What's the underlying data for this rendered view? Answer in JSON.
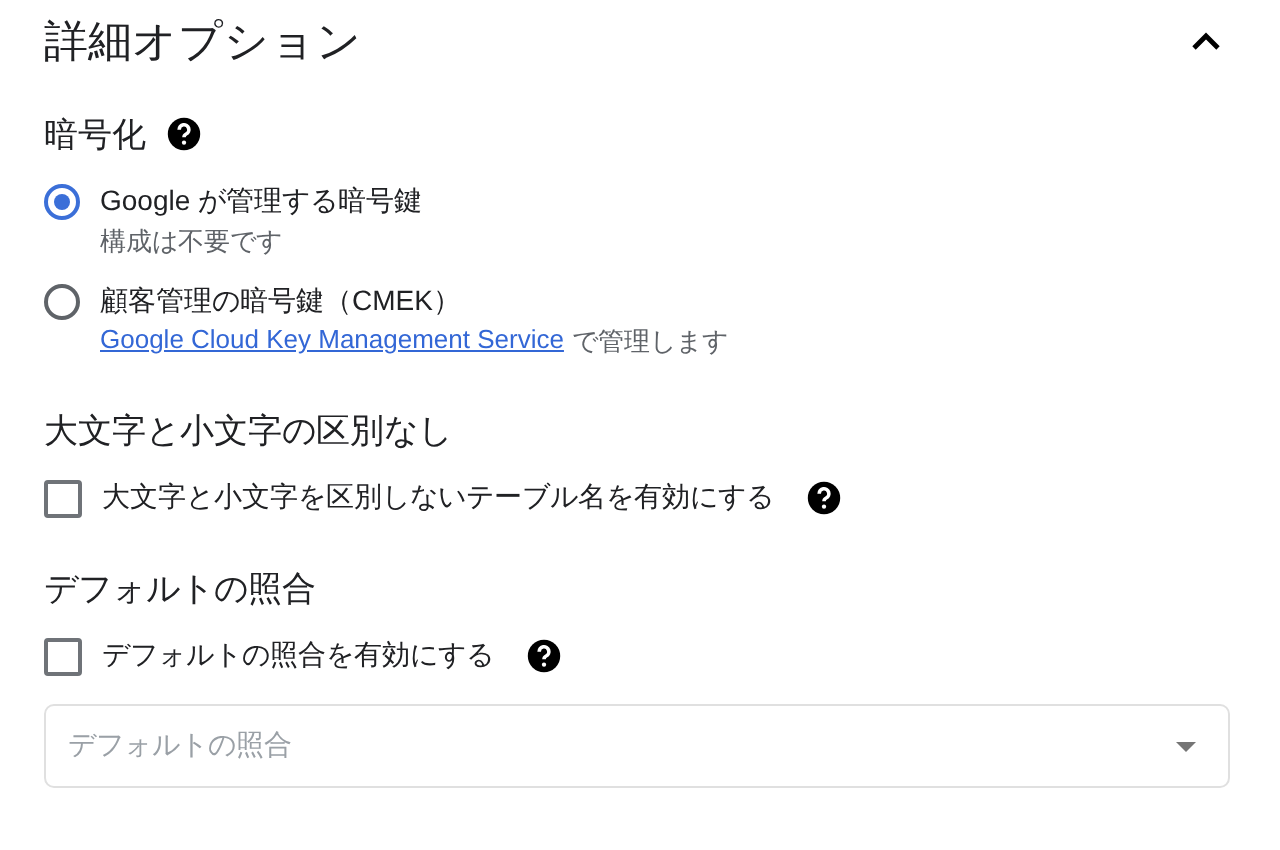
{
  "section": {
    "title": "詳細オプション",
    "expanded": true
  },
  "groups": [
    {
      "kind": "radio",
      "title": "暗号化",
      "help": true,
      "options": [
        {
          "label": "Google が管理する暗号鍵",
          "description": "構成は不要です",
          "selected": true
        },
        {
          "label": "顧客管理の暗号鍵（CMEK）",
          "link": "Google Cloud Key Management Service",
          "description": "で管理します",
          "selected": false
        }
      ]
    },
    {
      "kind": "checkbox",
      "title": "大文字と小文字の区別なし",
      "options": [
        {
          "label": "大文字と小文字を区別しないテーブル名を有効にする",
          "help": true,
          "checked": false
        }
      ]
    },
    {
      "kind": "checkbox",
      "title": "デフォルトの照合",
      "options": [
        {
          "label": "デフォルトの照合を有効にする",
          "help": true,
          "checked": false
        }
      ],
      "select": {
        "placeholder": "デフォルトの照合",
        "disabled": true
      }
    }
  ]
}
